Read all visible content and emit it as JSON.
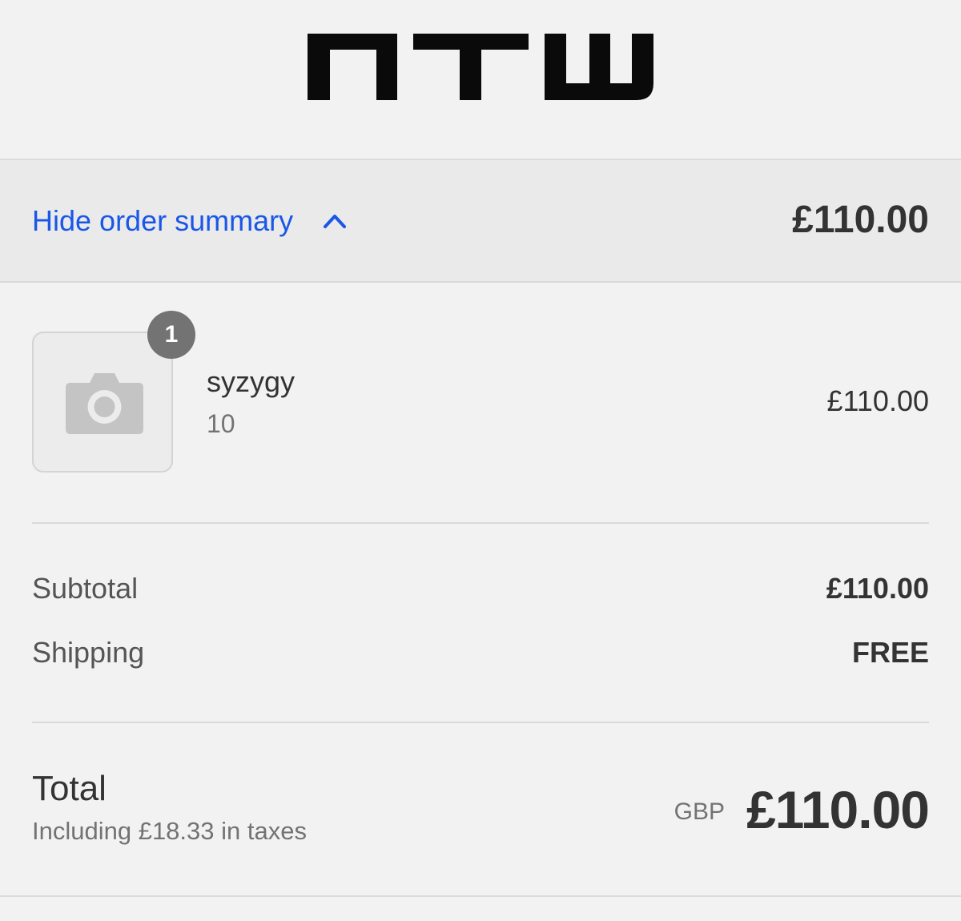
{
  "store": {
    "logo_icon": "ntw-logo"
  },
  "summary_toggle": {
    "label": "Hide order summary",
    "icon": "chevron-up-icon",
    "total": "£110.00",
    "accent_color": "#1a56e8"
  },
  "line_items": [
    {
      "name": "syzygy",
      "variant": "10",
      "quantity": "1",
      "price": "£110.00",
      "image_icon": "camera-icon"
    }
  ],
  "totals": {
    "subtotal_label": "Subtotal",
    "subtotal_value": "£110.00",
    "shipping_label": "Shipping",
    "shipping_value": "FREE",
    "total_label": "Total",
    "tax_note": "Including £18.33 in taxes",
    "currency": "GBP",
    "total_value": "£110.00"
  }
}
